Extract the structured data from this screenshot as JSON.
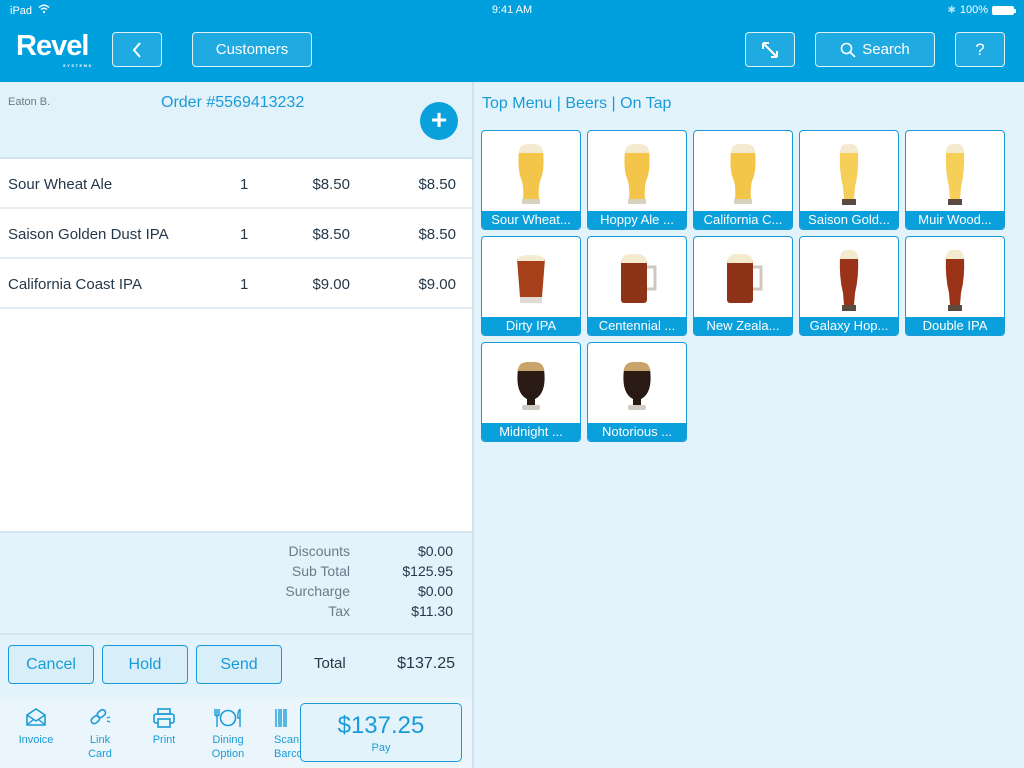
{
  "status_bar": {
    "device": "iPad",
    "time": "9:41 AM",
    "battery": "100%"
  },
  "header": {
    "logo_word": "Revel",
    "logo_sub": "SYSTEMS",
    "back_label": "<",
    "customers_label": "Customers",
    "expand_icon": "↘↖",
    "search_label": "Search",
    "help_label": "?"
  },
  "order": {
    "customer": "Eaton B.",
    "number": "Order #5569413232",
    "add_label": "+",
    "items": [
      {
        "name": "Sour Wheat Ale",
        "qty": "1",
        "price": "$8.50",
        "total": "$8.50"
      },
      {
        "name": "Saison Golden Dust IPA",
        "qty": "1",
        "price": "$8.50",
        "total": "$8.50"
      },
      {
        "name": "California Coast IPA",
        "qty": "1",
        "price": "$9.00",
        "total": "$9.00"
      }
    ],
    "summary": [
      {
        "label": "Discounts",
        "value": "$0.00"
      },
      {
        "label": "Sub Total",
        "value": "$125.95"
      },
      {
        "label": "Surcharge",
        "value": "$0.00"
      },
      {
        "label": "Tax",
        "value": "$11.30"
      }
    ],
    "total_label": "Total",
    "total_value": "$137.25"
  },
  "actions": {
    "cancel": "Cancel",
    "hold": "Hold",
    "send": "Send"
  },
  "tools": {
    "invoice": "Invoice",
    "link_card_1": "Link",
    "link_card_2": "Card",
    "print": "Print",
    "dining_1": "Dining",
    "dining_2": "Option",
    "scan_1": "Scan",
    "scan_2": "Barcode",
    "pay_amount": "$137.25",
    "pay_label": "Pay"
  },
  "menu": {
    "breadcrumb": "Top Menu | Beers | On Tap",
    "products": [
      {
        "label": "Sour Wheat...",
        "style": "pint",
        "color": "#f3c64a"
      },
      {
        "label": "Hoppy Ale ...",
        "style": "pint",
        "color": "#f3c64a"
      },
      {
        "label": "California C...",
        "style": "pint",
        "color": "#f3c64a"
      },
      {
        "label": "Saison Gold...",
        "style": "tall",
        "color": "#f5cf58"
      },
      {
        "label": "Muir Wood...",
        "style": "tall",
        "color": "#f5cf58"
      },
      {
        "label": "Dirty IPA",
        "style": "rocks",
        "color": "#a5401a"
      },
      {
        "label": "Centennial ...",
        "style": "mug",
        "color": "#8e3218"
      },
      {
        "label": "New Zeala...",
        "style": "mug",
        "color": "#8e3218"
      },
      {
        "label": "Galaxy Hop...",
        "style": "tall",
        "color": "#9a3318"
      },
      {
        "label": "Double IPA",
        "style": "tall",
        "color": "#9a3318"
      },
      {
        "label": "Midnight ...",
        "style": "snifter",
        "color": "#2a1a14"
      },
      {
        "label": "Notorious ...",
        "style": "snifter",
        "color": "#2a1a14"
      }
    ]
  }
}
